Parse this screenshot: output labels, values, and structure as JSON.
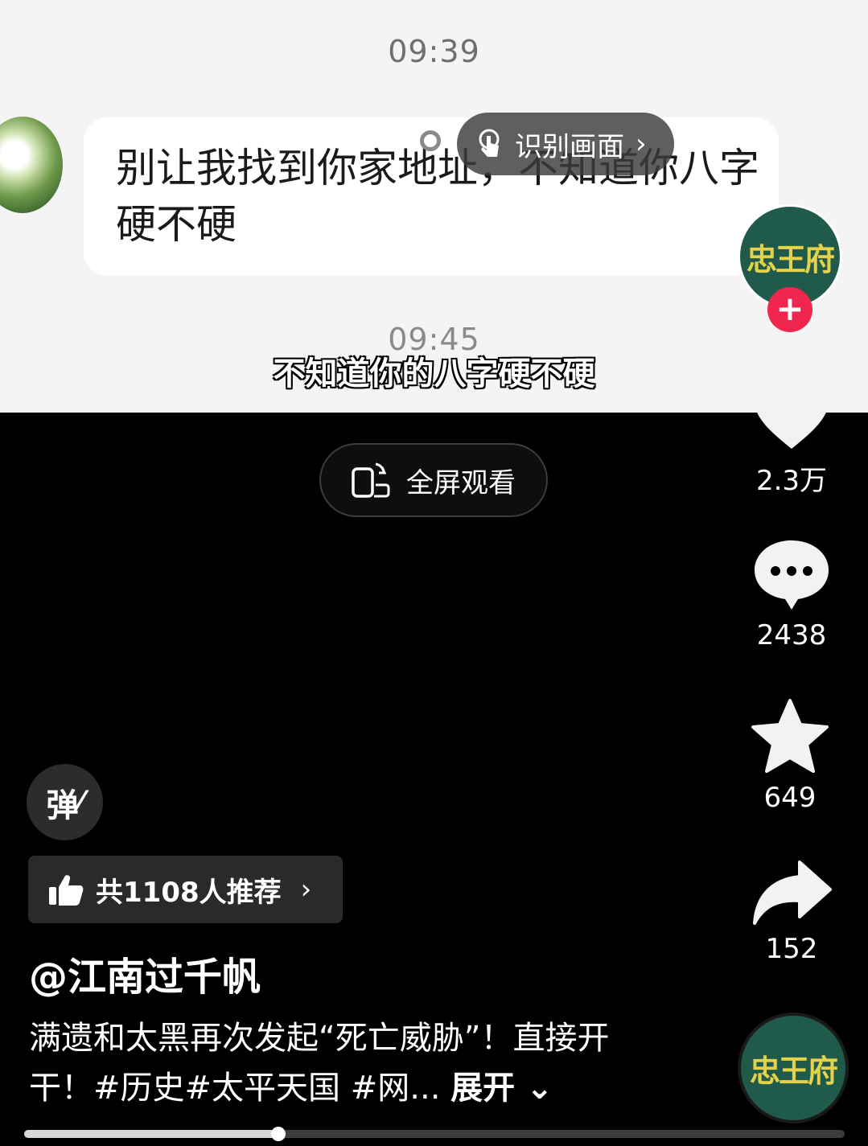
{
  "video": {
    "chat_time_1": "09:39",
    "chat_message": "别让我找到你家地址，不知道你八字硬不硬",
    "chat_time_2": "09:45",
    "recognize_label": "识别画面",
    "subtitle": "不知道你的八字硬不硬",
    "fullscreen_label": "全屏观看"
  },
  "author": {
    "avatar_text": "忠王府",
    "follow_symbol": "+",
    "handle": "@江南过千帆"
  },
  "actions": {
    "likes": "2.3万",
    "comments": "2438",
    "favorites": "649",
    "shares": "152"
  },
  "danmu_label": "弹",
  "recommend_label": "共1108人推荐",
  "caption": {
    "text": "满遗和太黑再次发起“死亡威胁”！直接开干！#历史#太平天国 #网...",
    "expand_label": "展开"
  },
  "music_disc_text": "忠王府",
  "progress": {
    "fraction": 0.31
  },
  "colors": {
    "accent_red": "#f0264f",
    "avatar_green": "#1f5a4a",
    "logo_gold": "#e4d24a"
  }
}
